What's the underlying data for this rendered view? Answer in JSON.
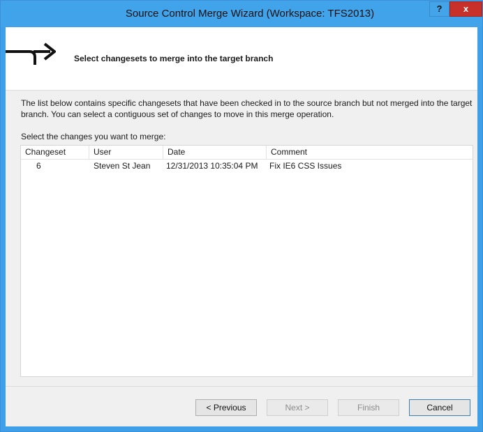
{
  "window": {
    "title": "Source Control Merge Wizard (Workspace: TFS2013)",
    "help_label": "?",
    "close_label": "x"
  },
  "header": {
    "icon": "merge-arrow-icon",
    "title": "Select changesets to merge into the target branch"
  },
  "description": "The list below contains specific changesets that have been checked in to the source branch but not merged into the target branch. You can select a contiguous set of changes to move in this merge operation.",
  "list": {
    "label": "Select the changes you want to merge:",
    "columns": [
      "Changeset",
      "User",
      "Date",
      "Comment"
    ],
    "rows": [
      {
        "changeset": "6",
        "user": "Steven St Jean",
        "date": "12/31/2013 10:35:04 PM",
        "comment": "Fix IE6 CSS Issues"
      }
    ]
  },
  "buttons": {
    "previous": "< Previous",
    "next": "Next >",
    "finish": "Finish",
    "cancel": "Cancel"
  },
  "colors": {
    "titlebar": "#41a3ea",
    "close": "#c7312a",
    "client": "#f0f0f0"
  }
}
